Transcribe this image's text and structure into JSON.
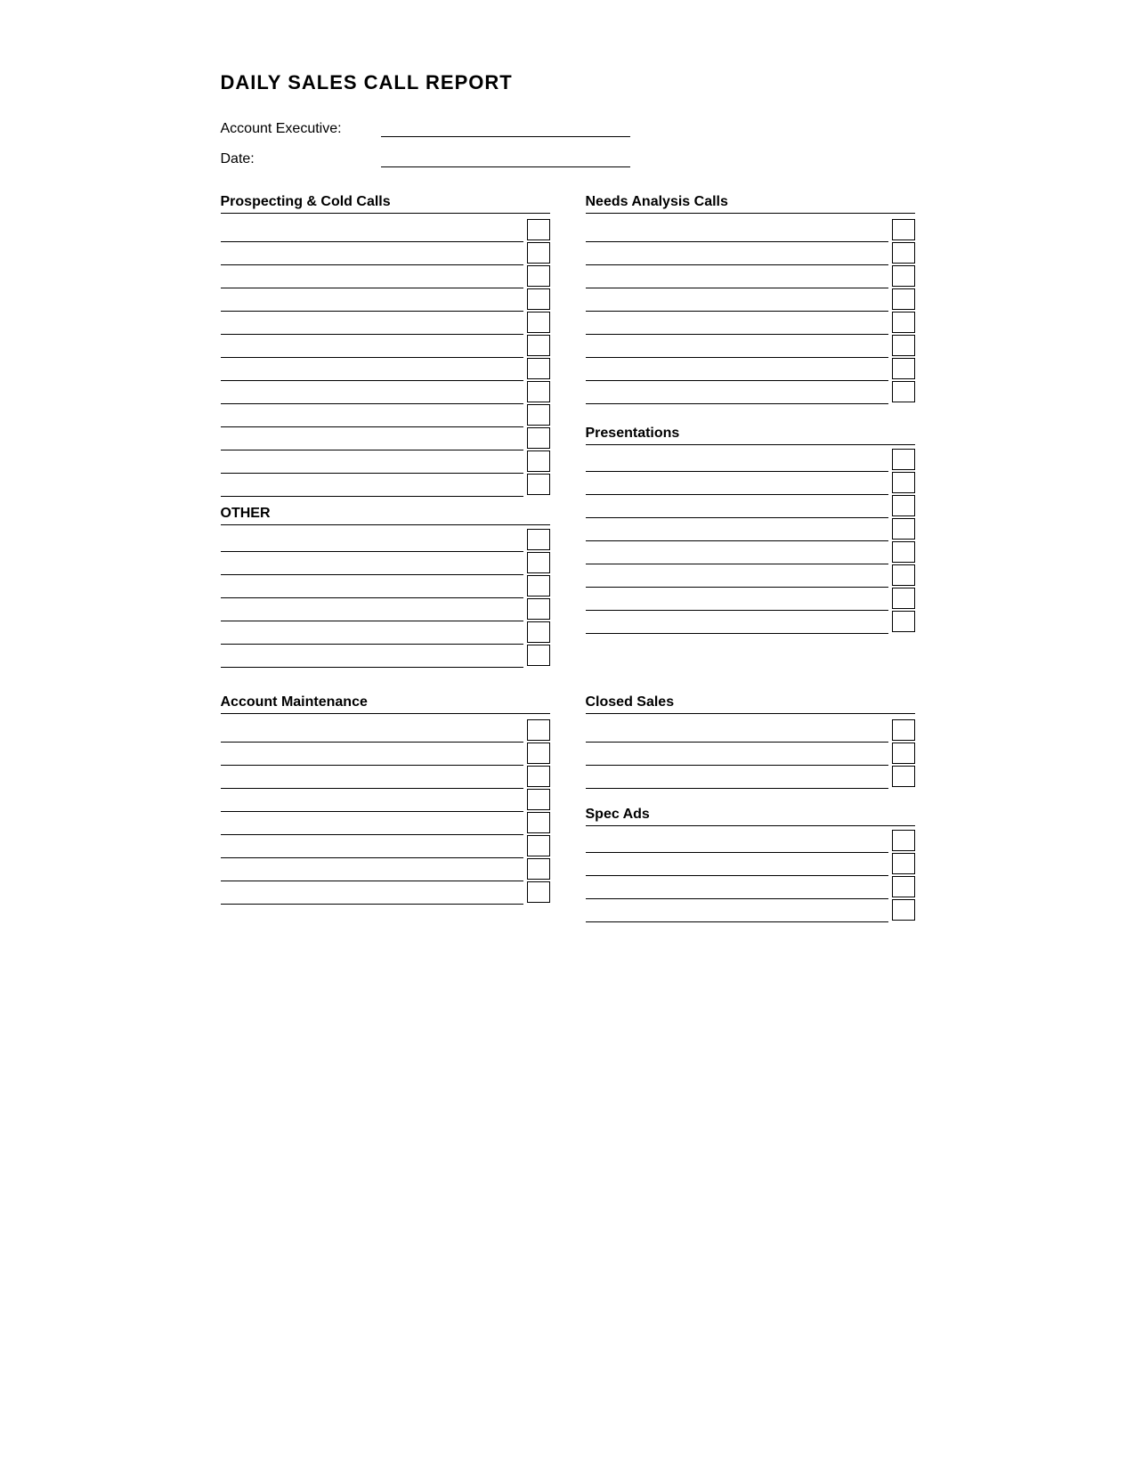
{
  "title": "DAILY SALES CALL REPORT",
  "fields": {
    "account_executive_label": "Account Executive:",
    "date_label": "Date:"
  },
  "sections": {
    "prospecting_title": "Prospecting & Cold Calls",
    "needs_analysis_title": "Needs Analysis Calls",
    "other_title": "OTHER",
    "presentations_title": "Presentations",
    "account_maintenance_title": "Account Maintenance",
    "closed_sales_title": "Closed Sales",
    "spec_ads_title": "Spec Ads"
  },
  "row_counts": {
    "prospecting_rows": 12,
    "other_rows": 6,
    "needs_analysis_rows": 8,
    "presentations_rows": 8,
    "account_maintenance_rows": 8,
    "closed_sales_rows": 3,
    "spec_ads_rows": 4
  }
}
